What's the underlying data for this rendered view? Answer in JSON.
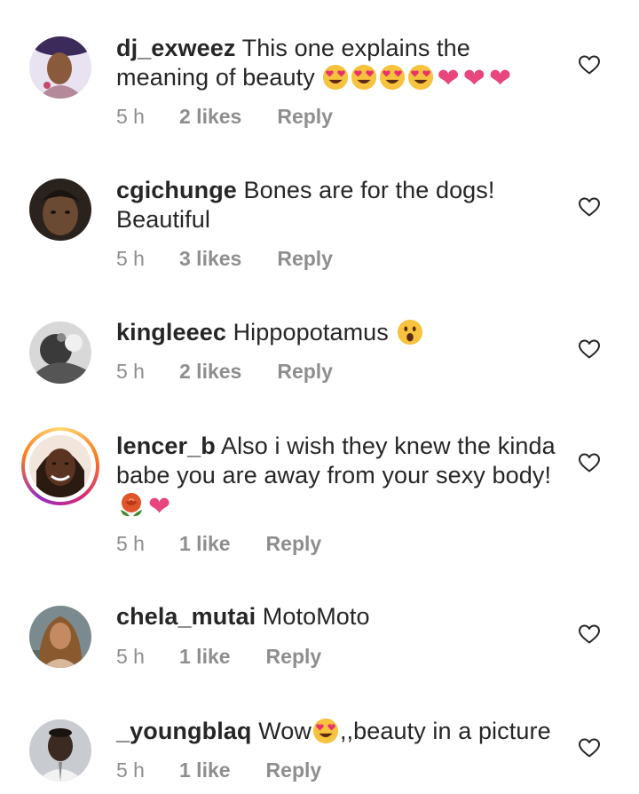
{
  "comments": [
    {
      "username": "dj_exweez",
      "text": " This one explains the meaning of beauty ",
      "emojis": [
        "heart-eyes-emoji",
        "heart-eyes-emoji",
        "heart-eyes-emoji",
        "heart-eyes-emoji",
        "pink-heart",
        "pink-heart",
        "pink-heart"
      ],
      "time": "5 h",
      "likes": "2 likes",
      "reply": "Reply"
    },
    {
      "username": "cgichunge",
      "text": " Bones are for the dogs! Beautiful",
      "time": "5 h",
      "likes": "3 likes",
      "reply": "Reply"
    },
    {
      "username": "kingleeec",
      "text": " Hippopotamus ",
      "emojis": [
        "astonished-emoji"
      ],
      "time": "5 h",
      "likes": "2 likes",
      "reply": "Reply"
    },
    {
      "username": "lencer_b",
      "text": " Also i wish they knew the kinda babe you are away from your sexy body! ",
      "emojis": [
        "rose-emoji",
        "pink-heart"
      ],
      "time": "5 h",
      "likes": "1 like",
      "reply": "Reply"
    },
    {
      "username": "chela_mutai",
      "text": " MotoMoto",
      "time": "5 h",
      "likes": "1 like",
      "reply": "Reply"
    },
    {
      "username": "_youngblaq",
      "text_before": " Wow",
      "text_after": ",,beauty in a picture",
      "emojis": [
        "heart-eyes-emoji"
      ],
      "time": "5 h",
      "likes": "1 like",
      "reply": "Reply"
    }
  ],
  "colors": {
    "text": "#262626",
    "secondary": "#8e8e8e",
    "heart_emoji": "#e8467c"
  }
}
